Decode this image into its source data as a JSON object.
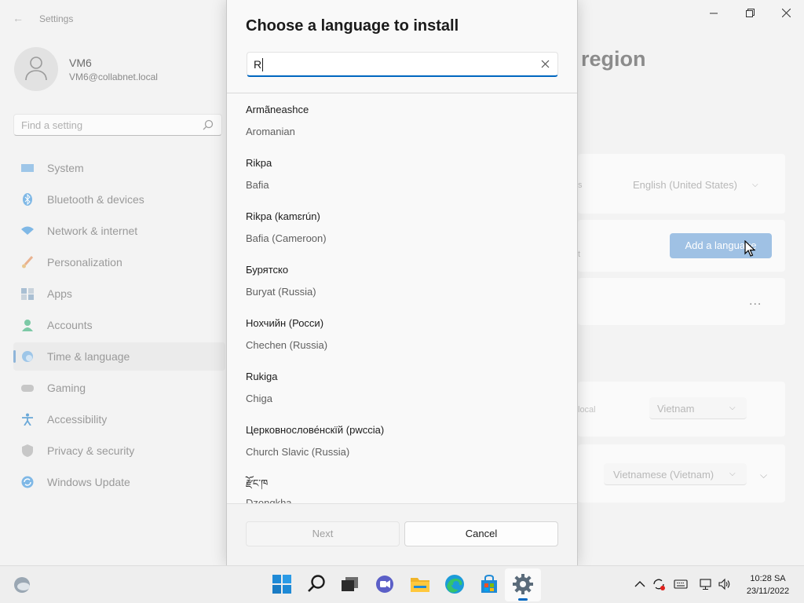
{
  "settings": {
    "app_title": "Settings",
    "profile": {
      "name": "VM6",
      "email": "VM6@collabnet.local"
    },
    "search_placeholder": "Find a setting",
    "nav": [
      {
        "label": "System",
        "icon": "monitor-icon"
      },
      {
        "label": "Bluetooth & devices",
        "icon": "bluetooth-icon"
      },
      {
        "label": "Network & internet",
        "icon": "wifi-icon"
      },
      {
        "label": "Personalization",
        "icon": "brush-icon"
      },
      {
        "label": "Apps",
        "icon": "apps-icon"
      },
      {
        "label": "Accounts",
        "icon": "person-icon"
      },
      {
        "label": "Time & language",
        "icon": "clock-globe-icon",
        "active": true
      },
      {
        "label": "Gaming",
        "icon": "controller-icon"
      },
      {
        "label": "Accessibility",
        "icon": "accessibility-icon"
      },
      {
        "label": "Privacy & security",
        "icon": "shield-icon"
      },
      {
        "label": "Windows Update",
        "icon": "update-icon"
      }
    ],
    "page_heading_fragment": "region",
    "display_language_fragment": "s",
    "display_language_value": "English (United States)",
    "preferred_fragment": "t",
    "add_language_label": "Add a language",
    "more_label": "...",
    "region_fragment": "local",
    "region_value": "Vietnam",
    "regional_format_value": "Vietnamese (Vietnam)"
  },
  "dialog": {
    "title": "Choose a language to install",
    "search_value": "R",
    "languages": [
      {
        "native": "Armãneashce",
        "english": "Aromanian"
      },
      {
        "native": "Rikpa",
        "english": "Bafia"
      },
      {
        "native": "Rikpa (kamɛrún)",
        "english": "Bafia (Cameroon)"
      },
      {
        "native": "Бурятско",
        "english": "Buryat (Russia)"
      },
      {
        "native": "Нохчийн (Росси)",
        "english": "Chechen (Russia)"
      },
      {
        "native": "Rukiga",
        "english": "Chiga"
      },
      {
        "native": "Церковнослове́нскїй (рwссіа)",
        "english": "Church Slavic (Russia)"
      },
      {
        "native": "རྫོང་ཁ",
        "english": "Dzongkha"
      }
    ],
    "next_label": "Next",
    "cancel_label": "Cancel"
  },
  "taskbar": {
    "icons": [
      "weather-icon",
      "start-icon",
      "search-icon",
      "task-view-icon",
      "chat-icon",
      "file-explorer-icon",
      "edge-icon",
      "store-icon",
      "settings-icon"
    ],
    "time": "10:28 SA",
    "date": "23/11/2022"
  },
  "colors": {
    "accent": "#0067c0",
    "add_button": "#9fc1e4"
  }
}
